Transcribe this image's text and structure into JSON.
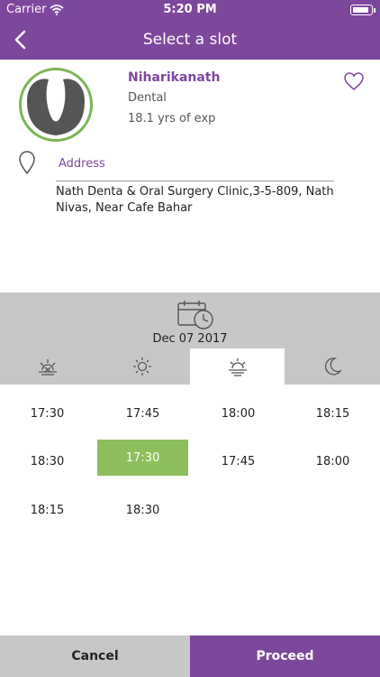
{
  "status_bar": {
    "carrier": "Carrier",
    "time": "5:20 PM",
    "battery_level": 0.92
  },
  "nav": {
    "title": "Select a slot",
    "back_icon": "chevron-left-icon"
  },
  "doctor": {
    "name": "Niharikanath",
    "speciality": "Dental",
    "experience": "18.1 yrs of exp",
    "favorite_icon": "heart-outline-icon",
    "avatar_icon": "tooth-icon"
  },
  "address": {
    "label": "Address",
    "text": "Nath Denta &  Oral Surgery Clinic,3-5-809, Nath Nivas, Near Cafe Bahar"
  },
  "date_panel": {
    "date": "Dec 07 2017",
    "icon": "calendar-clock-icon"
  },
  "tabs": [
    {
      "name": "sunrise-icon",
      "active": false
    },
    {
      "name": "sun-icon",
      "active": false
    },
    {
      "name": "sunset-icon",
      "active": true
    },
    {
      "name": "moon-icon",
      "active": false
    }
  ],
  "slots": [
    {
      "time": "17:30",
      "selected": false
    },
    {
      "time": "17:45",
      "selected": false
    },
    {
      "time": "18:00",
      "selected": false
    },
    {
      "time": "18:15",
      "selected": false
    },
    {
      "time": "18:30",
      "selected": false
    },
    {
      "time": "17:30",
      "selected": true
    },
    {
      "time": "17:45",
      "selected": false
    },
    {
      "time": "18:00",
      "selected": false
    },
    {
      "time": "18:15",
      "selected": false
    },
    {
      "time": "18:30",
      "selected": false
    }
  ],
  "footer": {
    "cancel_label": "Cancel",
    "proceed_label": "Proceed"
  },
  "colors": {
    "brand_purple": "#7d479c",
    "accent_green": "#8cbf5c",
    "panel_gray": "#c7c7c7",
    "avatar_ring": "#7cb553"
  }
}
